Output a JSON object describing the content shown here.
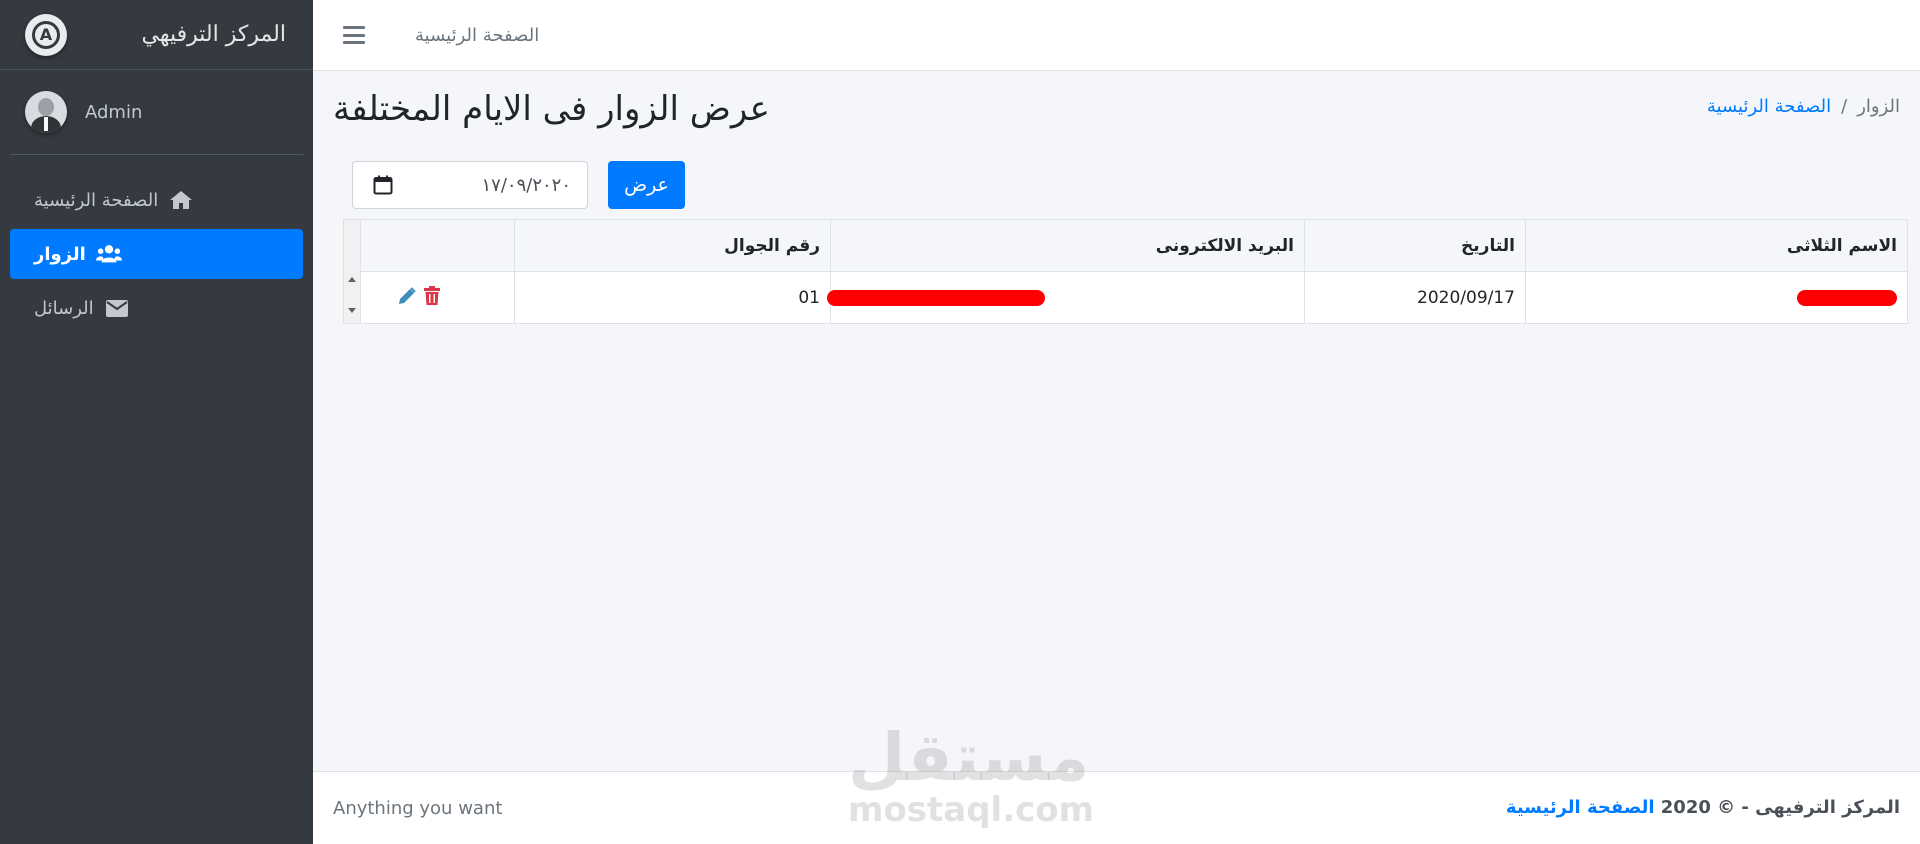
{
  "brand": {
    "title": "المركز الترفيهي"
  },
  "user": {
    "name": "Admin"
  },
  "sidebar": {
    "items": [
      {
        "label": "الصفحة الرئيسية",
        "icon": "home-icon",
        "active": false
      },
      {
        "label": "الزوار",
        "icon": "users-icon",
        "active": true
      },
      {
        "label": "الرسائل",
        "icon": "envelope-icon",
        "active": false
      }
    ]
  },
  "topbar": {
    "menu_icon": "hamburger-icon",
    "home_link": "الصفحة الرئيسية"
  },
  "content": {
    "title": "عرض الزوار فى الايام المختلفة",
    "breadcrumb": {
      "home": "الصفحة الرئيسية",
      "separator": "/",
      "current": "الزوار"
    }
  },
  "filter": {
    "date_value": "١٧/٠٩/٢٠٢٠",
    "submit_label": "عرض",
    "calendar_icon": "calendar-icon"
  },
  "table": {
    "columns": [
      "الاسم الثلاثى",
      "التاريخ",
      "البريد الالكترونى",
      "رقم الجوال",
      ""
    ],
    "rows": [
      {
        "name": "",
        "date": "2020/09/17",
        "email": "",
        "phone": "01"
      }
    ]
  },
  "footer": {
    "left": "Anything you want",
    "copyright": "المركز الترفيهى - © 2020",
    "home_link": "الصفحة الرئيسية"
  },
  "watermark": {
    "arabic": "مستقل",
    "latin": "mostaql.com"
  },
  "colors": {
    "sidebar_bg": "#343a40",
    "accent": "#007bff",
    "danger": "#dc3545",
    "page_bg": "#f4f6f9"
  }
}
